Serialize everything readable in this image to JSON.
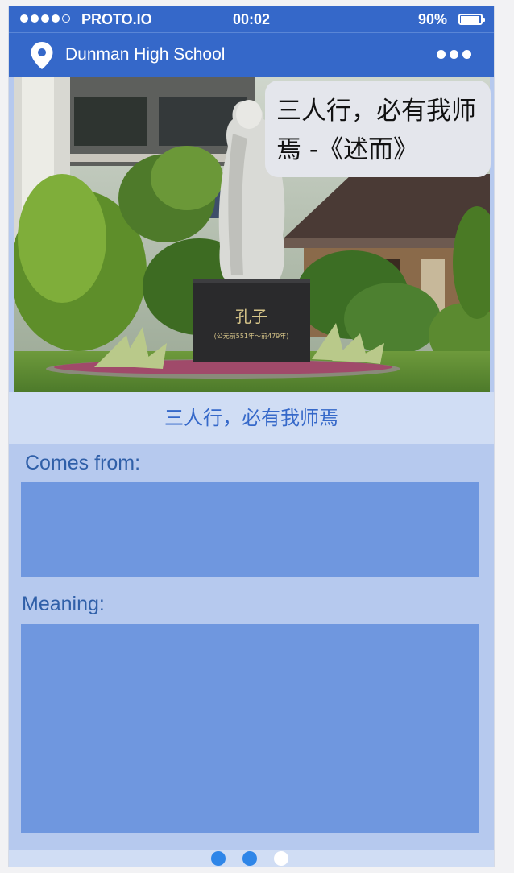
{
  "status_bar": {
    "carrier": "PROTO.IO",
    "time": "00:02",
    "battery_percent_label": "90%",
    "battery_level": 0.9,
    "signal_filled": 4,
    "signal_total": 5
  },
  "nav_bar": {
    "icon": "location-pin-icon",
    "title": "Dunman High School",
    "menu_icon": "more-dots-icon"
  },
  "hero": {
    "image": "confucius-statue-photo",
    "plaque_text": "孔子",
    "plaque_subtext": "(公元前551年～前479年)",
    "bubble_text": "三人行，必有我师焉 -《述而》"
  },
  "quote": {
    "text": "三人行，必有我师焉"
  },
  "sections": {
    "comes_from_label": "Comes from:",
    "meaning_label": "Meaning:"
  },
  "pager": {
    "total": 3,
    "active_index": 0
  },
  "colors": {
    "bar": "#3568c9",
    "quote_band": "#d0ddf4",
    "content_bg": "#b6c9ee",
    "box": "#6f97df",
    "label_text": "#2f5fa8",
    "pager_active": "#2f86e8"
  }
}
